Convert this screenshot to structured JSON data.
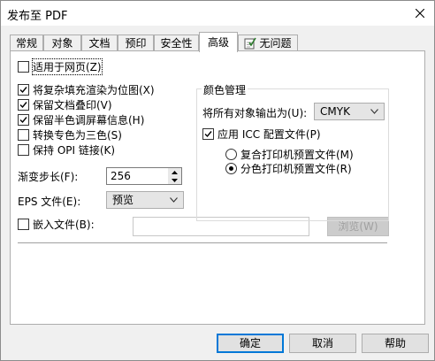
{
  "window": {
    "title": "发布至 PDF",
    "close_icon": "close-icon"
  },
  "tabs": [
    {
      "label": "常规",
      "active": false
    },
    {
      "label": "对象",
      "active": false
    },
    {
      "label": "文档",
      "active": false
    },
    {
      "label": "预印",
      "active": false
    },
    {
      "label": "安全性",
      "active": false
    },
    {
      "label": "高级",
      "active": true
    },
    {
      "label": "无问题",
      "active": false,
      "icon": "checklist-icon"
    }
  ],
  "advanced": {
    "web_optimize": {
      "label": "适用于网页(Z)",
      "checked": false
    },
    "options": [
      {
        "label": "将复杂填充渲染为位图(X)",
        "checked": true
      },
      {
        "label": "保留文档叠印(V)",
        "checked": true
      },
      {
        "label": "保留半色调屏幕信息(H)",
        "checked": true
      },
      {
        "label": "转换专色为三色(S)",
        "checked": false
      },
      {
        "label": "保持 OPI 链接(K)",
        "checked": false
      }
    ],
    "gradient_steps": {
      "label": "渐变步长(F):",
      "value": "256"
    },
    "eps_file": {
      "label": "EPS 文件(E):",
      "selected": "预览"
    },
    "embed_file": {
      "label": "嵌入文件(B):",
      "checked": false,
      "path": "",
      "browse_label": "浏览(W)"
    }
  },
  "color_management": {
    "title": "颜色管理",
    "output_label": "将所有对象输出为(U):",
    "output_value": "CMYK",
    "apply_icc": {
      "label": "应用 ICC 配置文件(P)",
      "checked": true
    },
    "profiles": [
      {
        "label": "复合打印机预置文件(M)",
        "selected": false
      },
      {
        "label": "分色打印机预置文件(R)",
        "selected": true
      }
    ]
  },
  "buttons": {
    "ok": "确定",
    "cancel": "取消",
    "help": "帮助"
  }
}
